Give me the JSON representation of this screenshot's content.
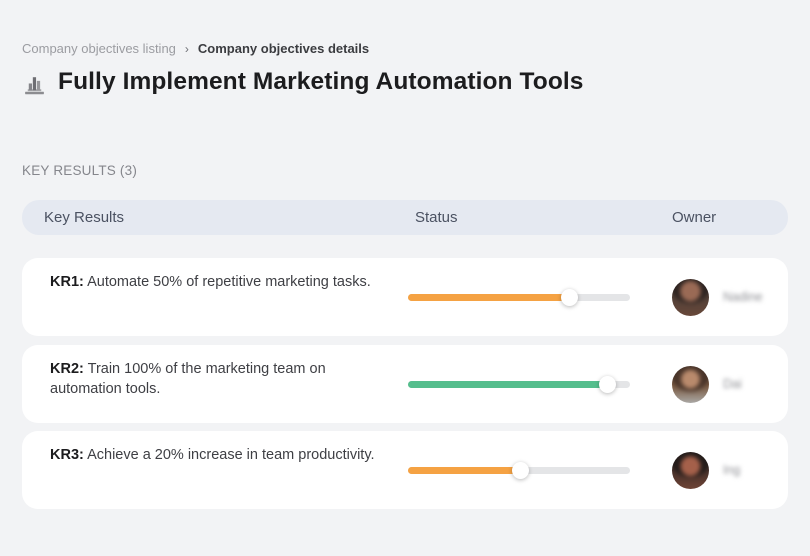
{
  "breadcrumb": {
    "items": [
      {
        "label": "Company objectives listing"
      },
      {
        "label": "Company objectives details"
      }
    ],
    "separator": "›"
  },
  "header": {
    "title": "Fully Implement Marketing Automation Tools",
    "icon": "bar-chart-building-icon"
  },
  "section": {
    "label": "KEY RESULTS (3)"
  },
  "table": {
    "columns": [
      "Key Results",
      "Status",
      "Owner"
    ],
    "track_color": "#E4E5E7",
    "rows": [
      {
        "kr": "KR1:",
        "text": "Automate 50% of repetitive marketing tasks.",
        "progress_percent": 73,
        "progress_color": "#F5A243",
        "owner": "Nadine"
      },
      {
        "kr": "KR2:",
        "text": "Train 100% of the marketing team on automation tools.",
        "progress_percent": 90,
        "progress_color": "#55BE8D",
        "owner": "Dai"
      },
      {
        "kr": "KR3:",
        "text": "Achieve a 20% increase in team productivity.",
        "progress_percent": 51,
        "progress_color": "#F5A243",
        "owner": "Ing"
      }
    ]
  },
  "colors": {
    "page_bg": "#F2F3F5",
    "card_bg": "#FFFFFF",
    "table_header_bg": "#E5E9F1",
    "accent_orange": "#F5A243",
    "accent_green": "#55BE8D"
  }
}
